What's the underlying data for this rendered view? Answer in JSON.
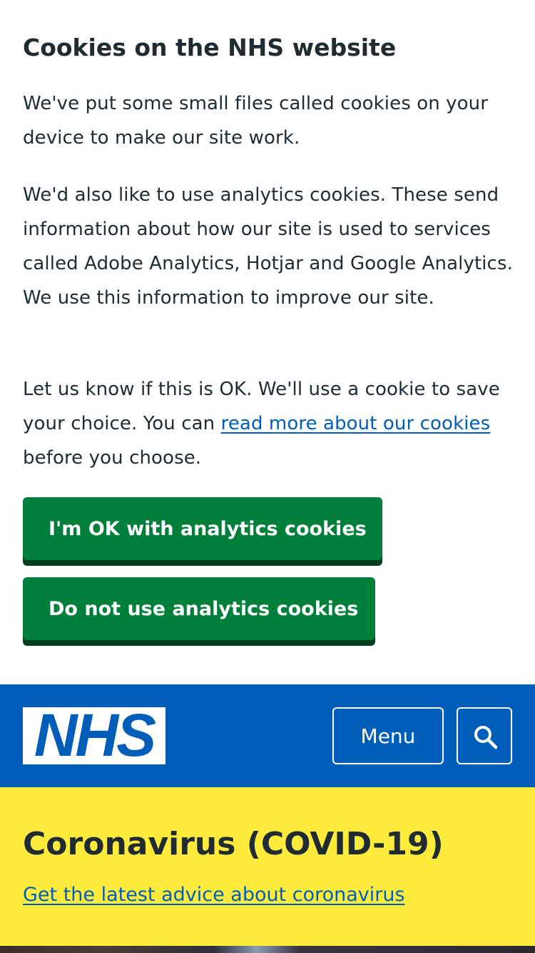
{
  "cookie_banner": {
    "title": "Cookies on the NHS website",
    "paragraph1": "We've put some small files called cookies on your device to make our site work.",
    "paragraph2": "We'd also like to use analytics cookies. These send information about how our site is used to services called Adobe Analytics, Hotjar and Google Analytics. We use this information to improve our site.",
    "paragraph3_before": "Let us know if this is OK. We'll use a cookie to save your choice. You can ",
    "paragraph3_link": "read more about our cookies",
    "paragraph3_after": " before you choose.",
    "accept_label": "I'm OK with analytics cookies",
    "reject_label": "Do not use analytics cookies"
  },
  "header": {
    "logo_text": "NHS",
    "menu_label": "Menu",
    "search_icon": "search-icon"
  },
  "alert": {
    "title": "Coronavirus (COVID-19)",
    "link": "Get the latest advice about coronavirus"
  },
  "colors": {
    "nhs_blue": "#005eb8",
    "nhs_green": "#007f3b",
    "nhs_green_shadow": "#00401e",
    "warm_yellow": "#ffeb3b",
    "text": "#212b32"
  }
}
